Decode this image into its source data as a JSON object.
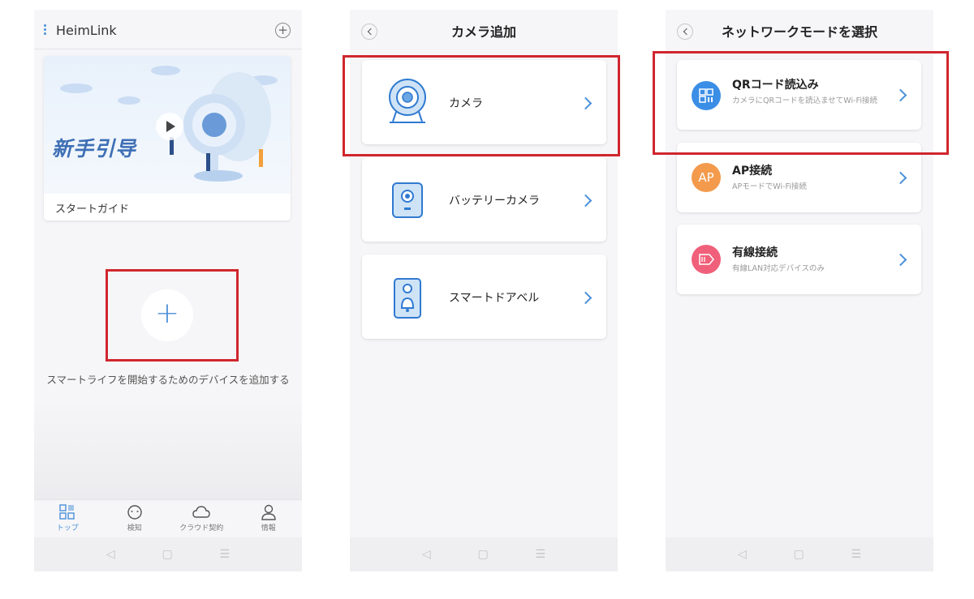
{
  "panel1": {
    "app_title": "HeimLink",
    "guide_banner_text": "新手引导",
    "guide_label": "スタートガイド",
    "add_prompt": "スマートライフを開始するためのデバイスを追加する",
    "add_symbol": "+",
    "header_add_symbol": "+",
    "tabs": [
      {
        "label": "トップ",
        "icon": "home-grid-icon",
        "active": true
      },
      {
        "label": "検知",
        "icon": "chat-bubble-icon",
        "active": false
      },
      {
        "label": "クラウド契約",
        "icon": "cloud-icon",
        "active": false
      },
      {
        "label": "情報",
        "icon": "person-icon",
        "active": false
      }
    ]
  },
  "panel2": {
    "title": "カメラ追加",
    "items": [
      {
        "label": "カメラ",
        "icon": "camera-icon"
      },
      {
        "label": "バッテリーカメラ",
        "icon": "battery-camera-icon"
      },
      {
        "label": "スマートドアベル",
        "icon": "doorbell-icon"
      }
    ]
  },
  "panel3": {
    "title": "ネットワークモードを選択",
    "items": [
      {
        "label": "QRコード読込み",
        "desc": "カメラにQRコードを読込ませてWi-Fi接続",
        "icon": "qr-code-icon",
        "color": "#3a8ee6"
      },
      {
        "label": "AP接続",
        "desc": "APモードでWi-Fi接続",
        "icon": "ap-icon",
        "icon_text": "AP",
        "color": "#f39a4c"
      },
      {
        "label": "有線接続",
        "desc": "有線LAN対応デバイスのみ",
        "icon": "ethernet-icon",
        "color": "#f0607a"
      }
    ]
  },
  "system_nav": {
    "back": "◁",
    "home": "▢",
    "menu": "☰"
  },
  "colors": {
    "accent": "#4a90d9",
    "highlight": "#d0262e"
  }
}
